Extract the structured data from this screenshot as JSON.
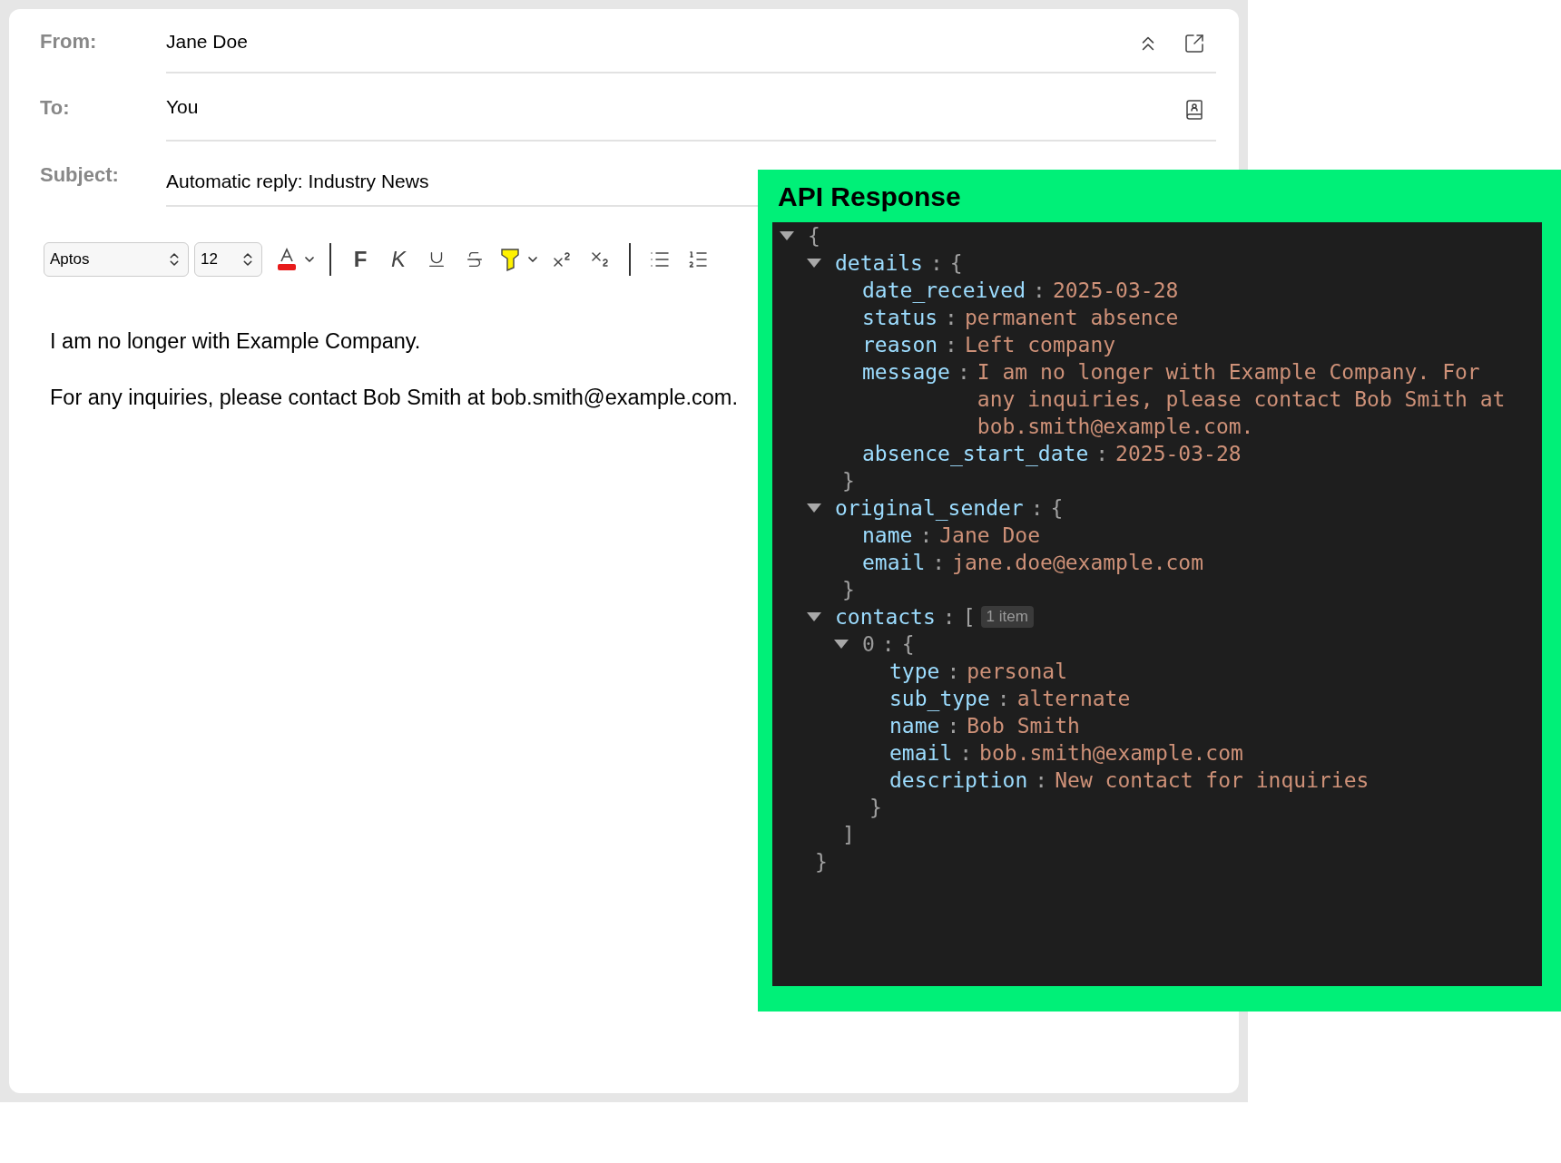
{
  "email": {
    "fields": [
      {
        "label": "From:",
        "value": "Jane Doe"
      },
      {
        "label": "To:",
        "value": "You"
      },
      {
        "label": "Subject:",
        "value": "Automatic reply: Industry News"
      }
    ],
    "toolbar": {
      "font": "Aptos",
      "size": "12",
      "bold": "F",
      "italic": "K"
    },
    "body": [
      "I am no longer with Example Company.",
      "For any inquiries, please contact Bob Smith at bob.smith@example.com."
    ]
  },
  "api_panel": {
    "title": "API Response",
    "tree": {
      "open": "{",
      "expanded": true,
      "close": "}",
      "children": [
        {
          "key": "details",
          "colon": ":",
          "open": "{",
          "expanded": true,
          "close": "}",
          "children": [
            {
              "key": "date_received",
              "colon": ":",
              "value": "2025-03-28"
            },
            {
              "key": "status",
              "colon": ":",
              "value": "permanent absence"
            },
            {
              "key": "reason",
              "colon": ":",
              "value": "Left company"
            },
            {
              "key": "message",
              "colon": ":",
              "value": "I am no longer with Example Company. For any inquiries, please contact Bob Smith at bob.smith@example.com."
            },
            {
              "key": "absence_start_date",
              "colon": ":",
              "value": "2025-03-28"
            }
          ]
        },
        {
          "key": "original_sender",
          "colon": ":",
          "open": "{",
          "expanded": true,
          "close": "}",
          "children": [
            {
              "key": "name",
              "colon": ":",
              "value": "Jane Doe"
            },
            {
              "key": "email",
              "colon": ":",
              "value": "jane.doe@example.com"
            }
          ]
        },
        {
          "key": "contacts",
          "colon": ":",
          "open": "[",
          "badge": "1 item",
          "expanded": true,
          "close": "]",
          "children": [
            {
              "key": "0",
              "kind": "index",
              "colon": ":",
              "open": "{",
              "expanded": true,
              "close": "}",
              "children": [
                {
                  "key": "type",
                  "colon": ":",
                  "value": "personal"
                },
                {
                  "key": "sub_type",
                  "colon": ":",
                  "value": "alternate"
                },
                {
                  "key": "name",
                  "colon": ":",
                  "value": "Bob Smith"
                },
                {
                  "key": "email",
                  "colon": ":",
                  "value": "bob.smith@example.com"
                },
                {
                  "key": "description",
                  "colon": ":",
                  "value": "New contact for inquiries"
                }
              ]
            }
          ]
        }
      ]
    }
  }
}
